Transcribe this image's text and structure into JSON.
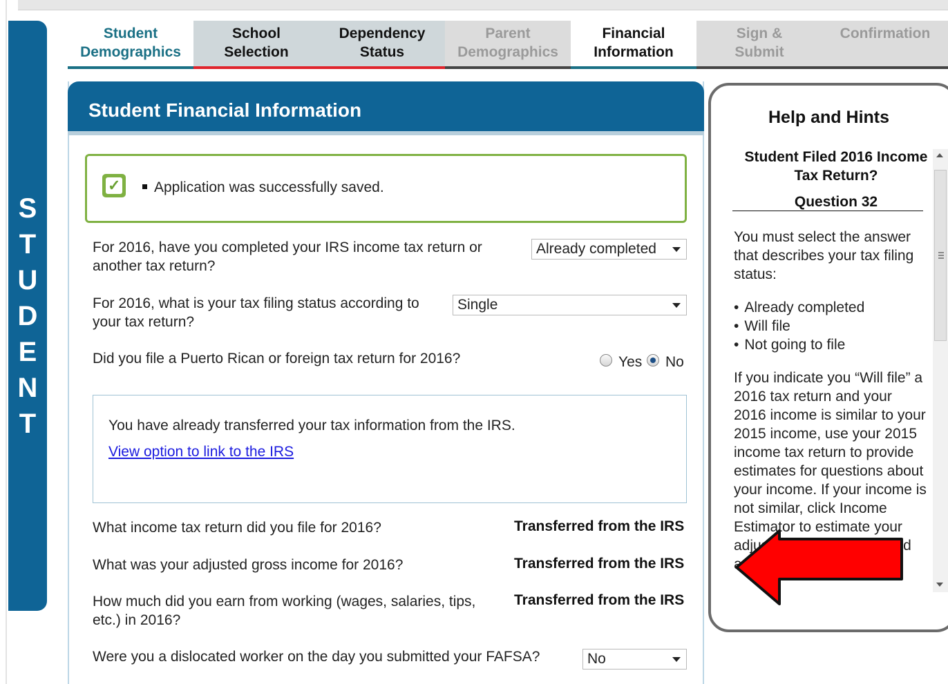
{
  "banner": {
    "letters": [
      "S",
      "T",
      "U",
      "D",
      "E",
      "N",
      "T"
    ]
  },
  "tabs": [
    {
      "line1": "Student",
      "line2": "Demographics",
      "state": "done"
    },
    {
      "line1": "School",
      "line2": "Selection",
      "state": "visited"
    },
    {
      "line1": "Dependency",
      "line2": "Status",
      "state": "visited"
    },
    {
      "line1": "Parent",
      "line2": "Demographics",
      "state": "future"
    },
    {
      "line1": "Financial",
      "line2": "Information",
      "state": "current"
    },
    {
      "line1": "Sign &",
      "line2": "Submit",
      "state": "future"
    },
    {
      "line1": "Confirmation",
      "line2": "",
      "state": "future"
    }
  ],
  "panel": {
    "title": "Student Financial Information"
  },
  "alert": {
    "message": "Application was successfully saved."
  },
  "questions": {
    "tax_return_q": "For 2016, have you completed your IRS income tax return or another tax return?",
    "tax_return_value": "Already completed",
    "filing_status_q": "For 2016, what is your tax filing status according to your tax return?",
    "filing_status_value": "Single",
    "foreign_q": "Did you file a Puerto Rican or foreign tax return for 2016?",
    "foreign_yes": "Yes",
    "foreign_no": "No",
    "foreign_selected": "No",
    "income_tax_q": "What income tax return did you file for 2016?",
    "agi_q": "What was your adjusted gross income for 2016?",
    "earned_q": "How much did you earn from working (wages, salaries, tips, etc.) in 2016?",
    "transferred": "Transferred from the IRS",
    "dislocated_q": "Were you a dislocated worker on the day you submitted your FAFSA?",
    "dislocated_value": "No"
  },
  "irs": {
    "message": "You have already transferred your tax information from the IRS.",
    "link": "View option to link to the IRS"
  },
  "help": {
    "title": "Help and Hints",
    "subtitle": "Student Filed 2016 Income Tax Return?",
    "question": "Question 32",
    "intro": "You must select the answer that describes your tax filing status:",
    "options": [
      "Already completed",
      "Will file",
      "Not going to file"
    ],
    "body": "If you indicate you “Will file” a 2016 tax return and your 2016 income is similar to your 2015 income, use your 2015 income tax return to provide estimates for questions about your income. If your income is not similar, click Income Estimator to estimate your adjusted gross income, and answer"
  },
  "colors": {
    "brand": "#0f6496",
    "success": "#7fb142",
    "accent_red": "#e0242c",
    "arrow": "#ff0000"
  }
}
